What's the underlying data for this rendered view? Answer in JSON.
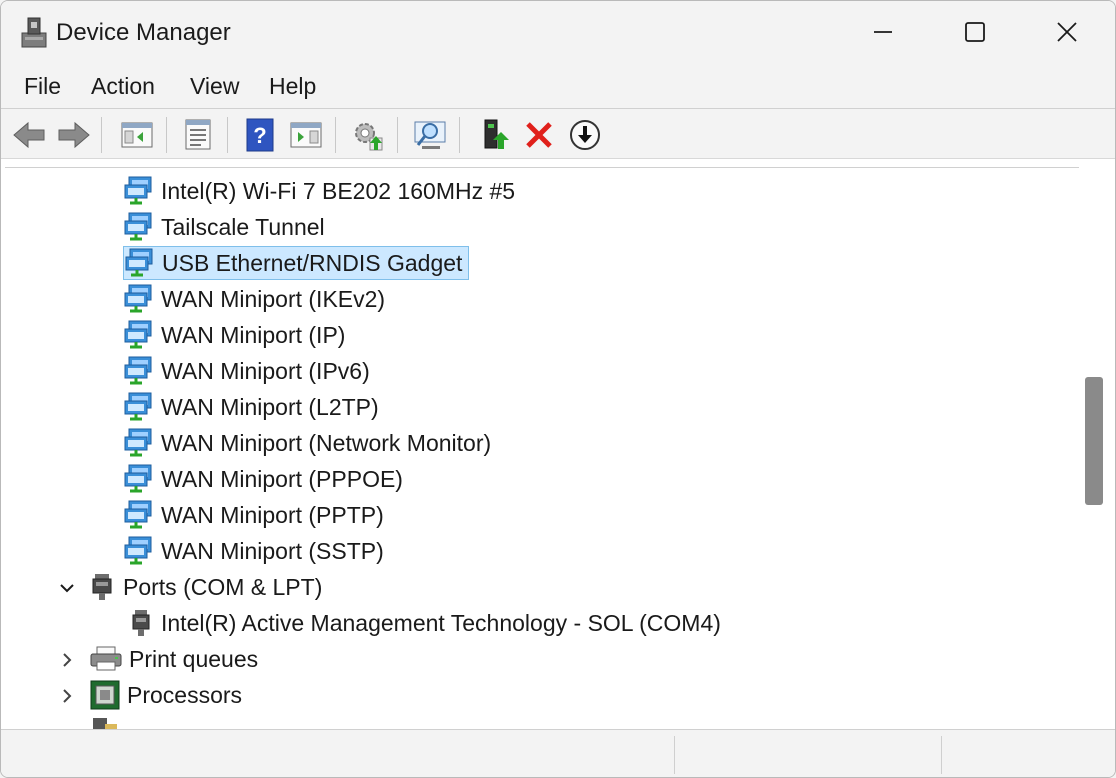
{
  "window": {
    "title": "Device Manager"
  },
  "titlebar": {
    "minimize_icon": "minimize-icon",
    "maximize_icon": "maximize-icon",
    "close_icon": "close-icon"
  },
  "menu": {
    "file": "File",
    "action": "Action",
    "view": "View",
    "help": "Help"
  },
  "toolbar": {
    "buttons": [
      "back-arrow-icon",
      "forward-arrow-icon",
      "show-hide-tree-icon",
      "properties-icon",
      "help-icon",
      "action-pane-icon",
      "update-driver-icon",
      "scan-hardware-icon",
      "enable-device-icon",
      "uninstall-icon",
      "disable-device-icon"
    ]
  },
  "tree": {
    "network_items": [
      "Intel(R) Wi-Fi 7 BE202 160MHz #5",
      "Tailscale Tunnel",
      "USB Ethernet/RNDIS Gadget",
      "WAN Miniport (IKEv2)",
      "WAN Miniport (IP)",
      "WAN Miniport (IPv6)",
      "WAN Miniport (L2TP)",
      "WAN Miniport (Network Monitor)",
      "WAN Miniport (PPPOE)",
      "WAN Miniport (PPTP)",
      "WAN Miniport (SSTP)"
    ],
    "selected_item": "USB Ethernet/RNDIS Gadget",
    "ports": {
      "label": "Ports (COM & LPT)",
      "expanded": true,
      "children": [
        "Intel(R) Active Management Technology - SOL (COM4)"
      ]
    },
    "print_queues": {
      "label": "Print queues",
      "expanded": false
    },
    "processors": {
      "label": "Processors",
      "expanded": false
    }
  },
  "colors": {
    "selection_bg": "#cce8ff",
    "selection_border": "#7fbfea",
    "chrome_bg": "#f3f3f3",
    "network_icon_blue": "#3a8fd8",
    "uninstall_red": "#e0201b",
    "update_green": "#2aa52a"
  }
}
